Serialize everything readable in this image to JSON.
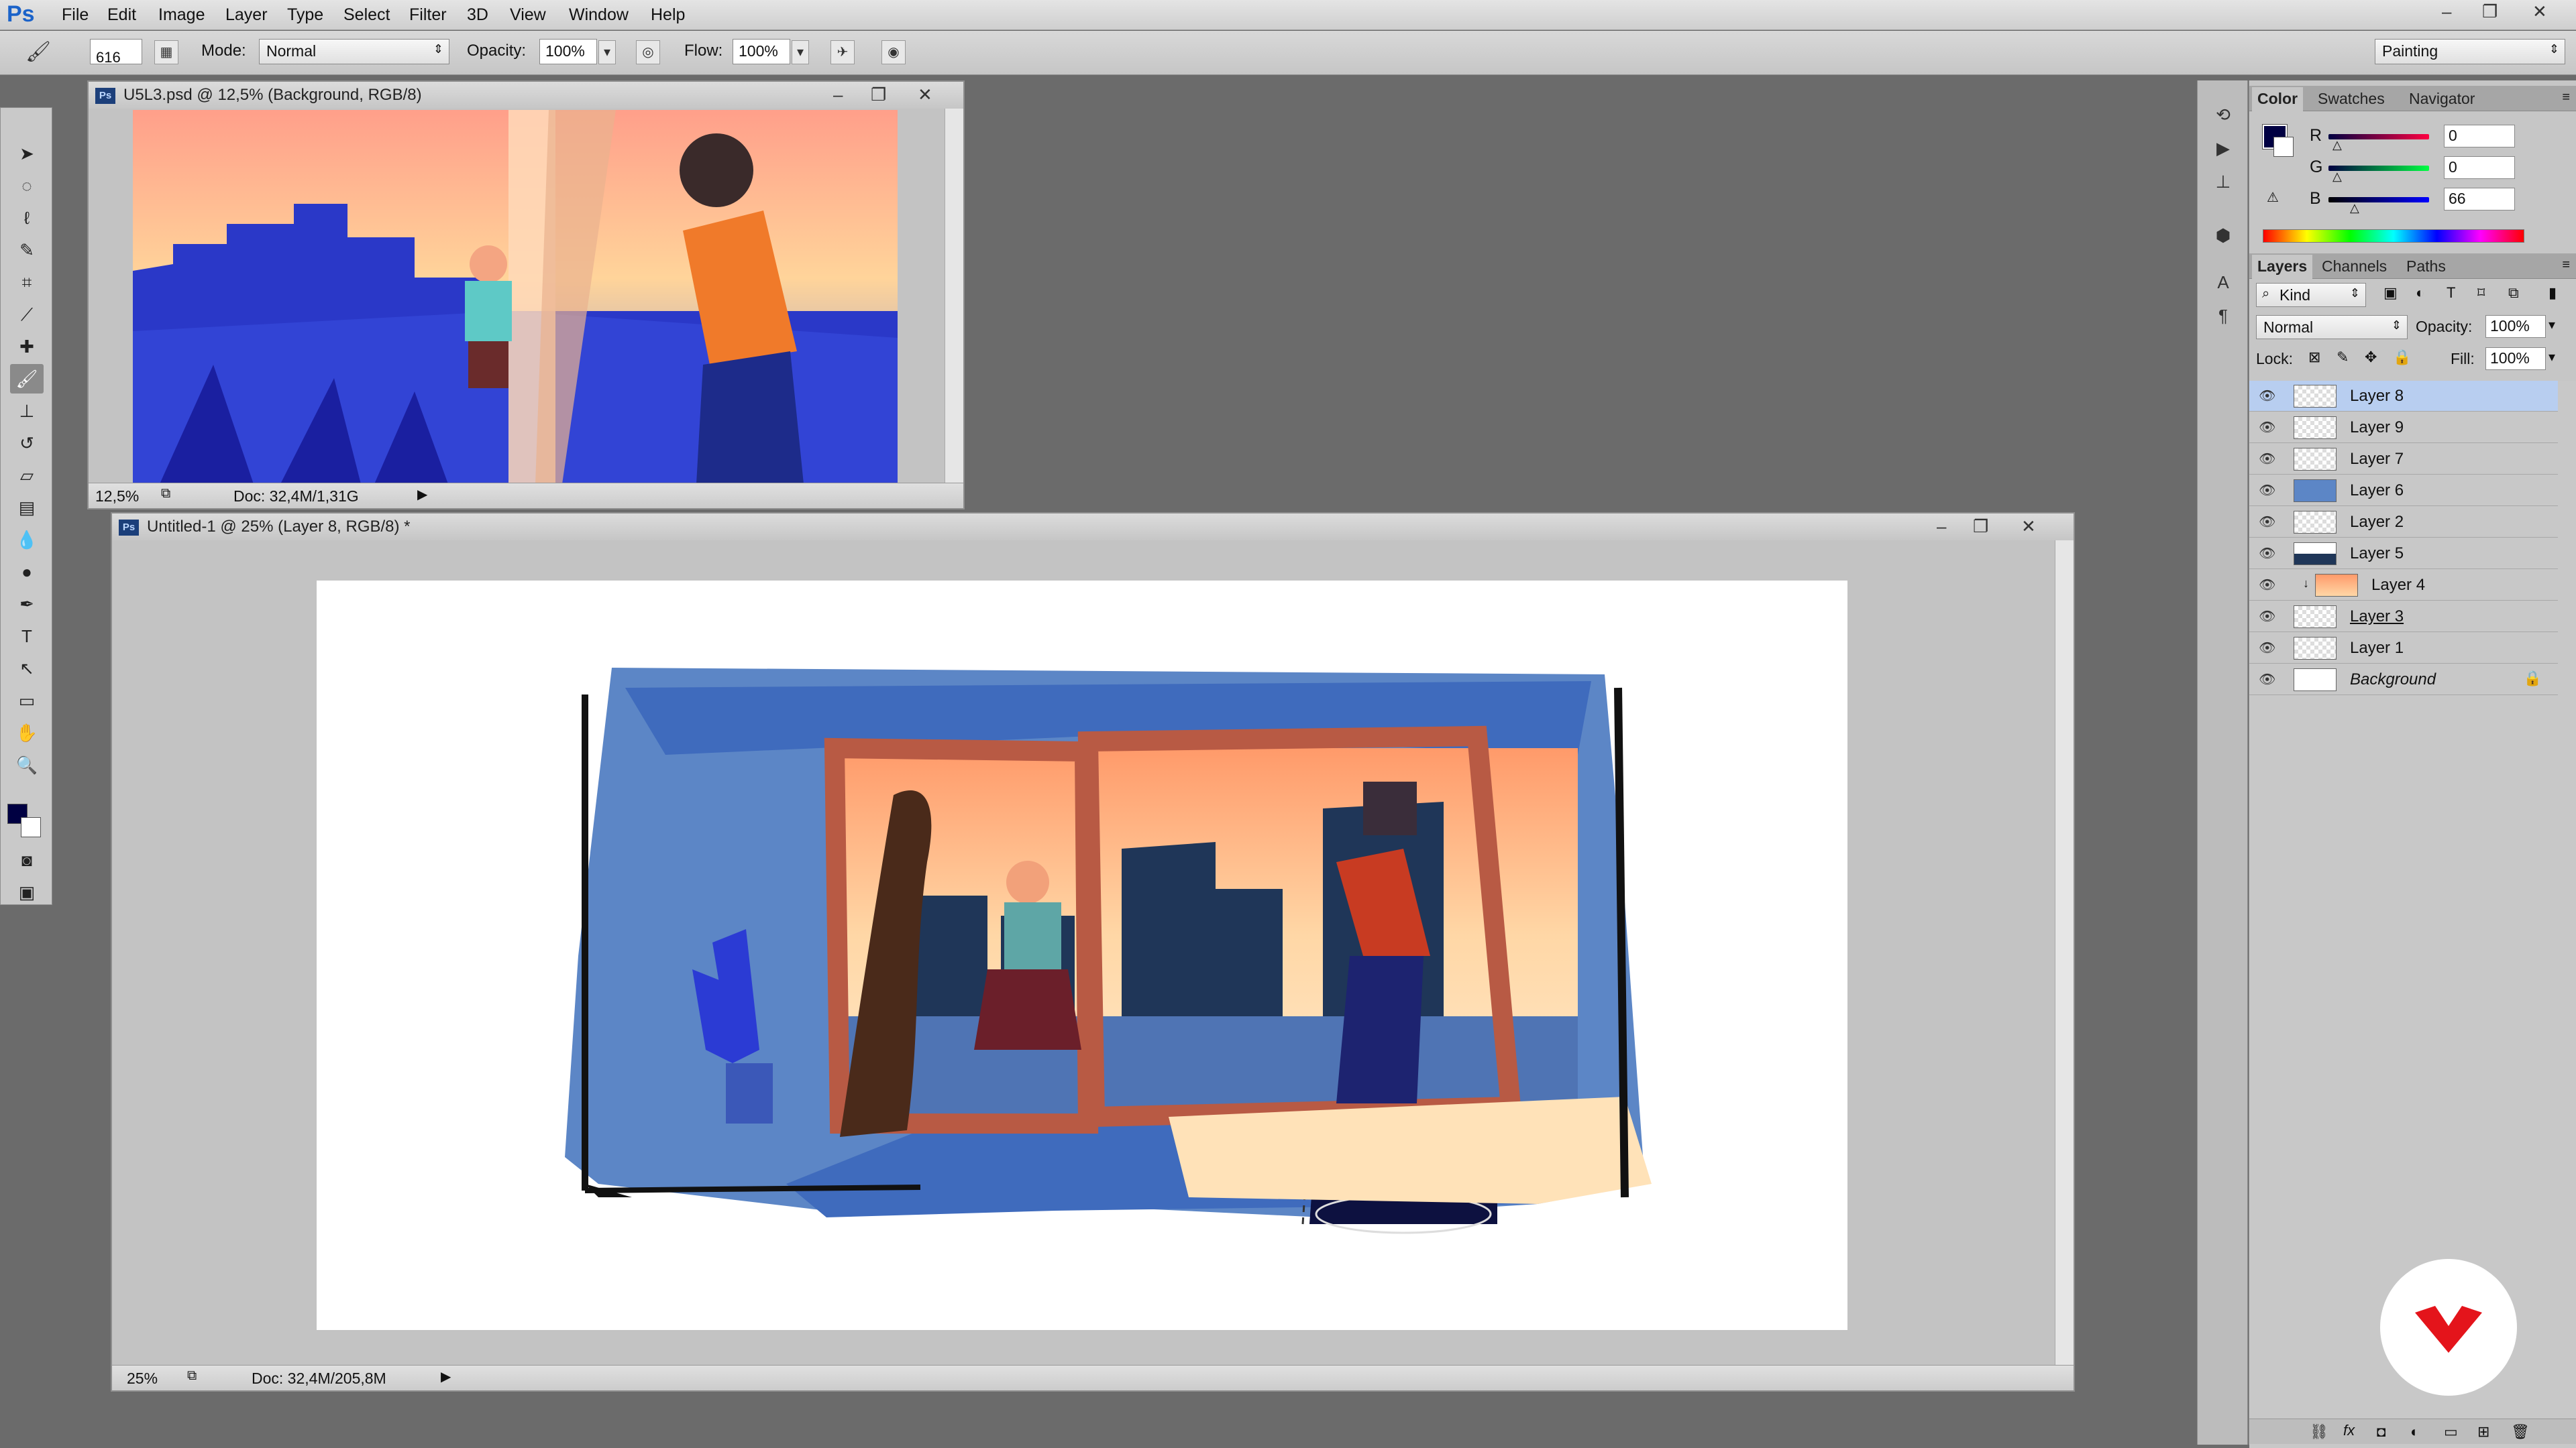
{
  "app": {
    "logo": "Ps"
  },
  "menu": [
    "File",
    "Edit",
    "Image",
    "Layer",
    "Type",
    "Select",
    "Filter",
    "3D",
    "View",
    "Window",
    "Help"
  ],
  "window_controls": {
    "minimize": "–",
    "restore": "❐",
    "close": "✕"
  },
  "options": {
    "brush_size": "616",
    "mode_label": "Mode:",
    "mode_value": "Normal",
    "opacity_label": "Opacity:",
    "opacity_value": "100%",
    "flow_label": "Flow:",
    "flow_value": "100%",
    "workspace": "Painting"
  },
  "doc1": {
    "title": "U5L3.psd @ 12,5% (Background, RGB/8)",
    "zoom": "12,5%",
    "doc_info": "Doc: 32,4M/1,31G"
  },
  "doc2": {
    "title": "Untitled-1 @ 25% (Layer 8, RGB/8) *",
    "zoom": "25%",
    "doc_info": "Doc: 32,4M/205,8M"
  },
  "color_panel": {
    "tabs": [
      "Color",
      "Swatches",
      "Navigator"
    ],
    "r_label": "R",
    "r_value": "0",
    "g_label": "G",
    "g_value": "0",
    "b_label": "B",
    "b_value": "66",
    "foreground": "#000042"
  },
  "layers_panel": {
    "tabs": [
      "Layers",
      "Channels",
      "Paths"
    ],
    "filter_kind": "Kind",
    "blend_mode": "Normal",
    "opacity_label": "Opacity:",
    "opacity_value": "100%",
    "lock_label": "Lock:",
    "fill_label": "Fill:",
    "fill_value": "100%",
    "layers": [
      {
        "name": "Layer 8",
        "active": true
      },
      {
        "name": "Layer 9"
      },
      {
        "name": "Layer 7"
      },
      {
        "name": "Layer 6"
      },
      {
        "name": "Layer 2"
      },
      {
        "name": "Layer 5"
      },
      {
        "name": "Layer 4",
        "clipped": true
      },
      {
        "name": "Layer 3"
      },
      {
        "name": "Layer 1"
      },
      {
        "name": "Background",
        "locked": true
      }
    ]
  },
  "colors": {
    "accent": "#1b63c9",
    "selection": "#b8cef0",
    "brand_red": "#e4141b"
  }
}
